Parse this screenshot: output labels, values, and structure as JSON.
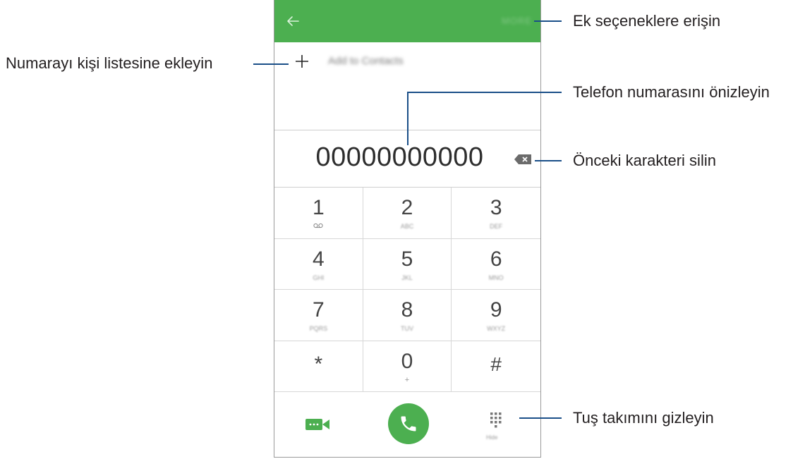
{
  "app_bar": {
    "more_label": "MORE"
  },
  "add_contacts": {
    "label": "Add to Contacts"
  },
  "number_display": {
    "value": "00000000000"
  },
  "keypad": {
    "keys": [
      {
        "digit": "1",
        "sub": ""
      },
      {
        "digit": "2",
        "sub": "ABC"
      },
      {
        "digit": "3",
        "sub": "DEF"
      },
      {
        "digit": "4",
        "sub": "GHI"
      },
      {
        "digit": "5",
        "sub": "JKL"
      },
      {
        "digit": "6",
        "sub": "MNO"
      },
      {
        "digit": "7",
        "sub": "PQRS"
      },
      {
        "digit": "8",
        "sub": "TUV"
      },
      {
        "digit": "9",
        "sub": "WXYZ"
      },
      {
        "digit": "*",
        "sub": ""
      },
      {
        "digit": "0",
        "sub": "+"
      },
      {
        "digit": "#",
        "sub": ""
      }
    ]
  },
  "bottom_bar": {
    "hide_label": "Hide"
  },
  "callouts": {
    "more_options": "Ek seçeneklere erişin",
    "add_to_contacts": "Numarayı kişi listesine ekleyin",
    "preview_number": "Telefon numarasını önizleyin",
    "delete_char": "Önceki karakteri silin",
    "hide_keypad": "Tuş takımını gizleyin"
  },
  "colors": {
    "accent": "#4caf50",
    "callout_line": "#1a4f88"
  },
  "icons": [
    "back-arrow-icon",
    "plus-icon",
    "backspace-icon",
    "voicemail-icon",
    "video-call-icon",
    "phone-icon",
    "dialpad-icon"
  ]
}
